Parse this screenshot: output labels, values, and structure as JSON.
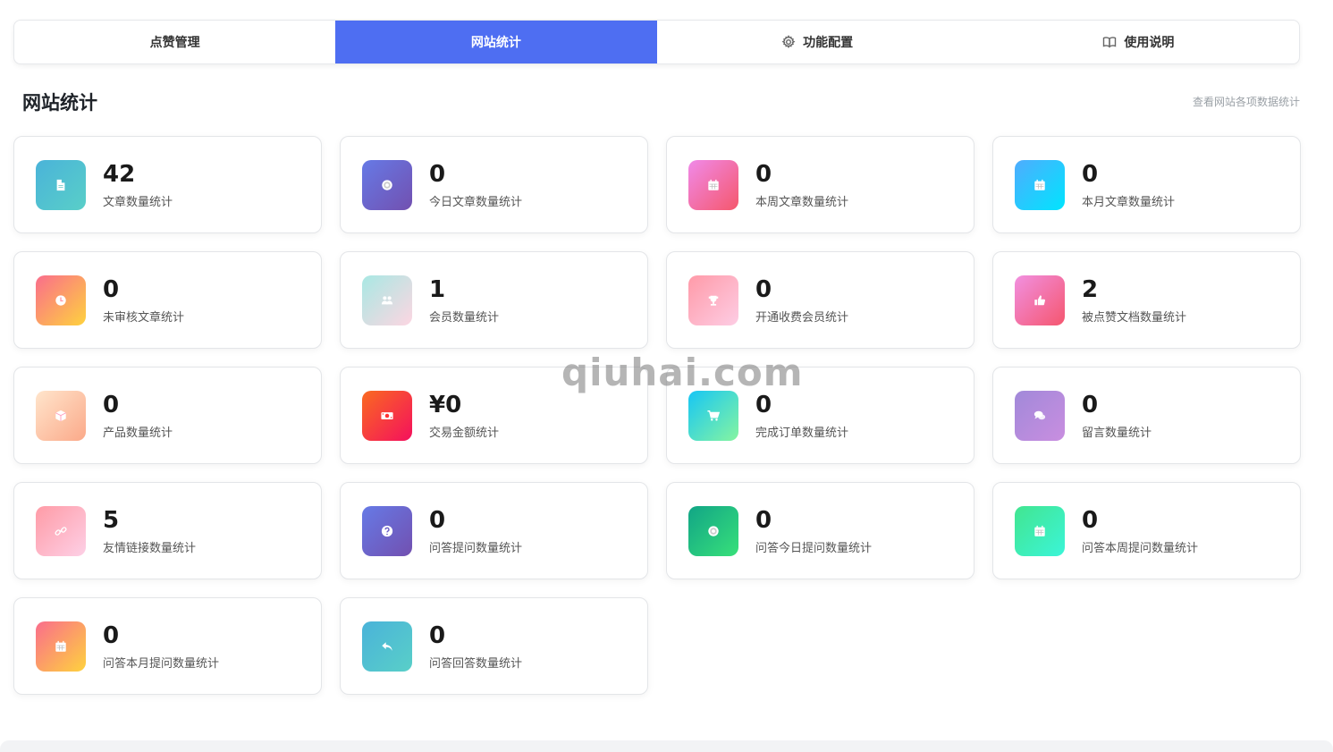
{
  "tabs": [
    {
      "label": "点赞管理",
      "icon": ""
    },
    {
      "label": "网站统计",
      "icon": ""
    },
    {
      "label": "功能配置",
      "icon": "gear-icon"
    },
    {
      "label": "使用说明",
      "icon": "book-icon"
    }
  ],
  "header": {
    "title": "网站统计",
    "description": "查看网站各项数据统计"
  },
  "stats": [
    {
      "value": "42",
      "label": "文章数量统计",
      "icon": "document-icon",
      "gradient": [
        "#4ab3d9",
        "#59cfc8"
      ]
    },
    {
      "value": "0",
      "label": "今日文章数量统计",
      "icon": "target-icon",
      "gradient": [
        "#667ae6",
        "#7250b0"
      ]
    },
    {
      "value": "0",
      "label": "本周文章数量统计",
      "icon": "calendar-icon",
      "gradient": [
        "#f08ae9",
        "#f5576c"
      ]
    },
    {
      "value": "0",
      "label": "本月文章数量统计",
      "icon": "calendar-icon",
      "gradient": [
        "#4facfe",
        "#00e5fe"
      ]
    },
    {
      "value": "0",
      "label": "未审核文章统计",
      "icon": "clock-icon",
      "gradient": [
        "#fa6d8c",
        "#fed23e"
      ]
    },
    {
      "value": "1",
      "label": "会员数量统计",
      "icon": "users-icon",
      "gradient": [
        "#a8e8e3",
        "#fdd6e2"
      ]
    },
    {
      "value": "0",
      "label": "开通收费会员统计",
      "icon": "trophy-icon",
      "gradient": [
        "#ff9aa8",
        "#fdcde4"
      ]
    },
    {
      "value": "2",
      "label": "被点赞文档数量统计",
      "icon": "thumbs-up-icon",
      "gradient": [
        "#f190e0",
        "#f5566f"
      ]
    },
    {
      "value": "0",
      "label": "产品数量统计",
      "icon": "box-icon",
      "gradient": [
        "#ffe5cc",
        "#fba989"
      ]
    },
    {
      "value": "¥0",
      "label": "交易金额统计",
      "icon": "money-icon",
      "gradient": [
        "#fa6a20",
        "#f4105d"
      ]
    },
    {
      "value": "0",
      "label": "完成订单数量统计",
      "icon": "cart-icon",
      "gradient": [
        "#16c6f5",
        "#86f5a0"
      ]
    },
    {
      "value": "0",
      "label": "留言数量统计",
      "icon": "comments-icon",
      "gradient": [
        "#a189d9",
        "#c98ee0"
      ]
    },
    {
      "value": "5",
      "label": "友情链接数量统计",
      "icon": "link-icon",
      "gradient": [
        "#ff9ba6",
        "#fdd0e6"
      ]
    },
    {
      "value": "0",
      "label": "问答提问数量统计",
      "icon": "question-icon",
      "gradient": [
        "#667ae6",
        "#7250b0"
      ]
    },
    {
      "value": "0",
      "label": "问答今日提问数量统计",
      "icon": "target-icon",
      "gradient": [
        "#11a586",
        "#38e07a"
      ]
    },
    {
      "value": "0",
      "label": "问答本周提问数量统计",
      "icon": "calendar-icon",
      "gradient": [
        "#42e590",
        "#3bf5d8"
      ]
    },
    {
      "value": "0",
      "label": "问答本月提问数量统计",
      "icon": "calendar-icon",
      "gradient": [
        "#fa6d8c",
        "#fed23e"
      ]
    },
    {
      "value": "0",
      "label": "问答回答数量统计",
      "icon": "reply-icon",
      "gradient": [
        "#4ab3d9",
        "#59cfc8"
      ]
    }
  ],
  "watermark": "qiuhai.com",
  "colors": {
    "accent": "#4e6ef2"
  }
}
